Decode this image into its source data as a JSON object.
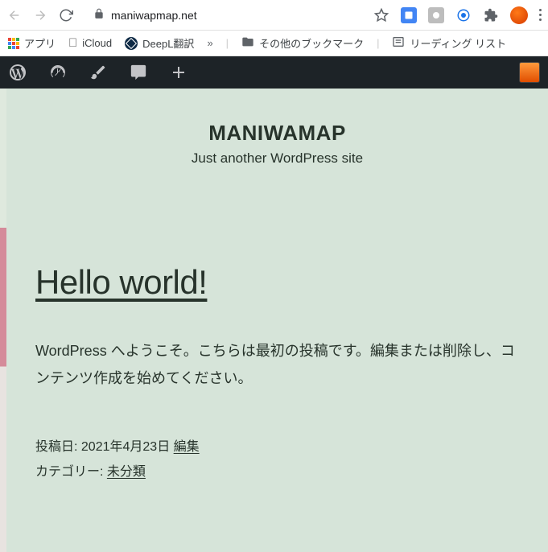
{
  "chrome": {
    "url_display": "maniwapmap.net",
    "url_host": "maniwapmap.net"
  },
  "bookmarks": {
    "apps": "アプリ",
    "icloud": "iCloud",
    "deepl": "DeepL翻訳",
    "other": "その他のブックマーク",
    "reading_list": "リーディング リスト",
    "more": "»"
  },
  "wp": {
    "site_title": "MANIWAMAP",
    "tagline": "Just another WordPress site"
  },
  "post": {
    "title": "Hello world!",
    "body": "WordPress へようこそ。こちらは最初の投稿です。編集または削除し、コンテンツ作成を始めてください。",
    "meta_date_label": "投稿日:",
    "meta_date_value": "2021年4月23日",
    "meta_edit": "編集",
    "meta_cat_label": "カテゴリー:",
    "meta_cat_value": "未分類"
  }
}
